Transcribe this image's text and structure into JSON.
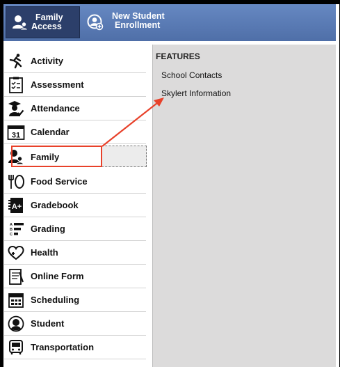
{
  "header": {
    "family_access": {
      "label_line1": "Family",
      "label_line2": "Access",
      "icon": "family-user-icon"
    },
    "new_student_enrollment": {
      "label_line1": "New Student",
      "label_line2": "Enrollment",
      "icon": "add-user-circle-icon"
    }
  },
  "sidebar": {
    "items": [
      {
        "label": "Activity",
        "icon": "running-person-icon"
      },
      {
        "label": "Assessment",
        "icon": "checklist-icon"
      },
      {
        "label": "Attendance",
        "icon": "student-graduate-icon"
      },
      {
        "label": "Calendar",
        "icon": "calendar-icon",
        "icon_text": "31"
      },
      {
        "label": "Family",
        "icon": "family-user-icon",
        "highlighted": true
      },
      {
        "label": "Food Service",
        "icon": "fork-plate-icon"
      },
      {
        "label": "Gradebook",
        "icon": "gradebook-icon",
        "icon_text": "A+"
      },
      {
        "label": "Grading",
        "icon": "grading-list-icon",
        "icon_text": [
          "A",
          "B",
          "C"
        ]
      },
      {
        "label": "Health",
        "icon": "heart-plus-icon"
      },
      {
        "label": "Online Form",
        "icon": "clipboard-form-icon"
      },
      {
        "label": "Scheduling",
        "icon": "schedule-grid-icon"
      },
      {
        "label": "Student",
        "icon": "student-circle-icon"
      },
      {
        "label": "Transportation",
        "icon": "bus-icon"
      }
    ]
  },
  "features": {
    "heading": "FEATURES",
    "links": [
      "School Contacts",
      "Skylert Information"
    ]
  },
  "colors": {
    "header_bar": "#5a7bb5",
    "family_button": "#2c3f6a",
    "highlight_border": "#e8412a",
    "panel_bg": "#dcdbdb"
  }
}
